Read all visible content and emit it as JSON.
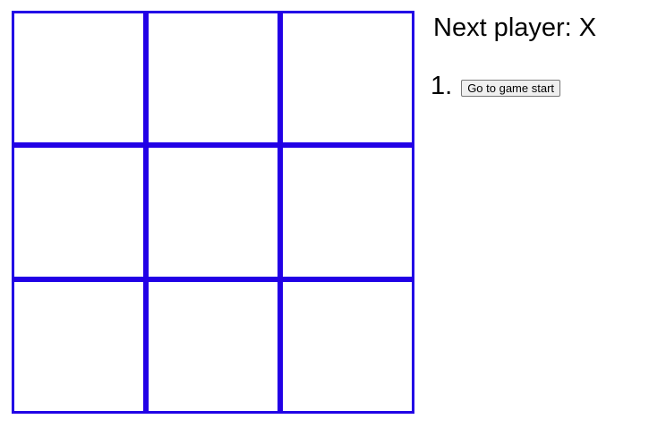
{
  "game": {
    "board": [
      "",
      "",
      "",
      "",
      "",
      "",
      "",
      "",
      ""
    ],
    "grid_color": "#2200e6"
  },
  "status": {
    "text": "Next player: X"
  },
  "history": [
    {
      "number": "1.",
      "label": "Go to game start"
    }
  ]
}
